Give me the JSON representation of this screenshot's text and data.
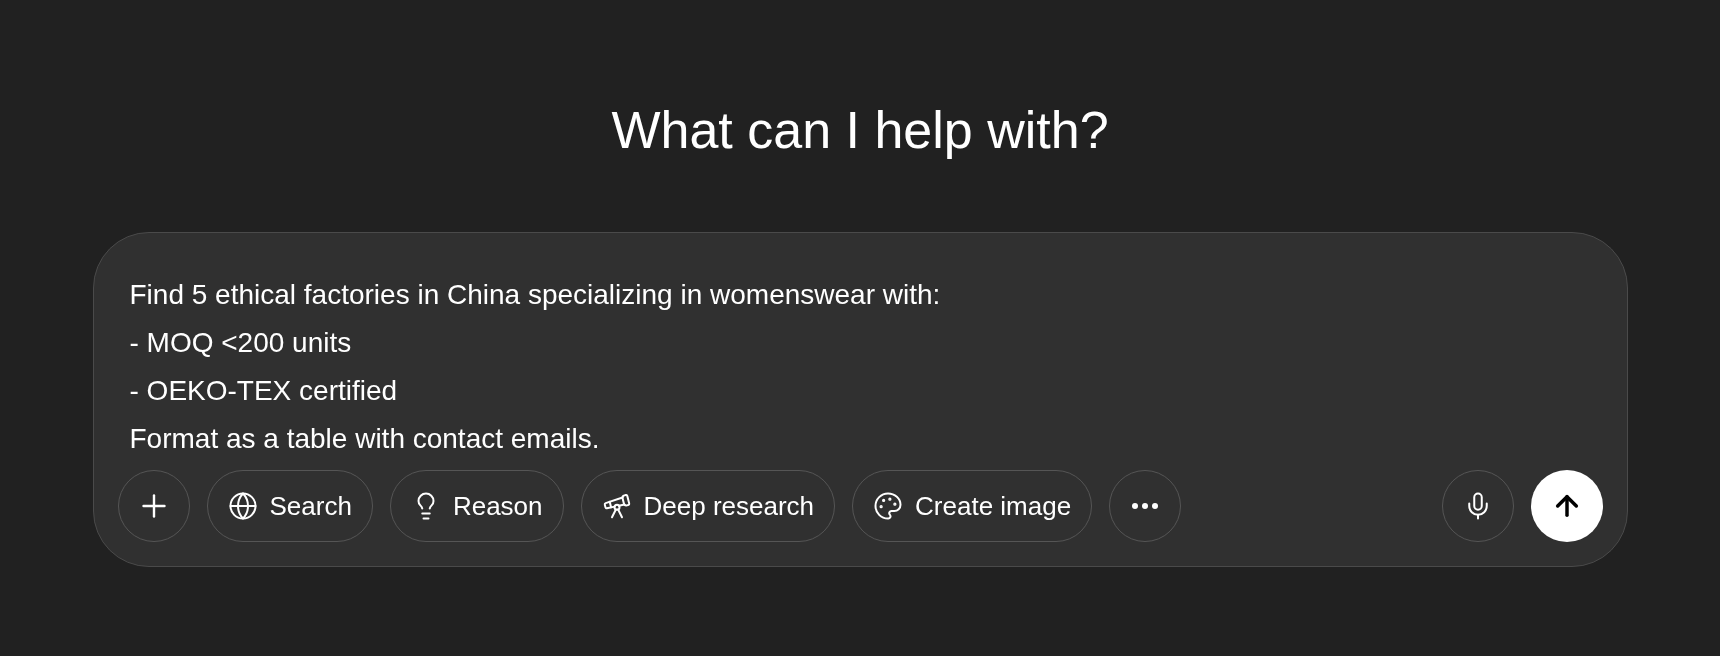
{
  "heading": "What can I help with?",
  "prompt": {
    "value": "Find 5 ethical factories in China specializing in womenswear with:\n- MOQ <200 units\n- OEKO-TEX certified\nFormat as a table with contact emails."
  },
  "tools": [
    {
      "label": "Search"
    },
    {
      "label": "Reason"
    },
    {
      "label": "Deep research"
    },
    {
      "label": "Create image"
    }
  ]
}
